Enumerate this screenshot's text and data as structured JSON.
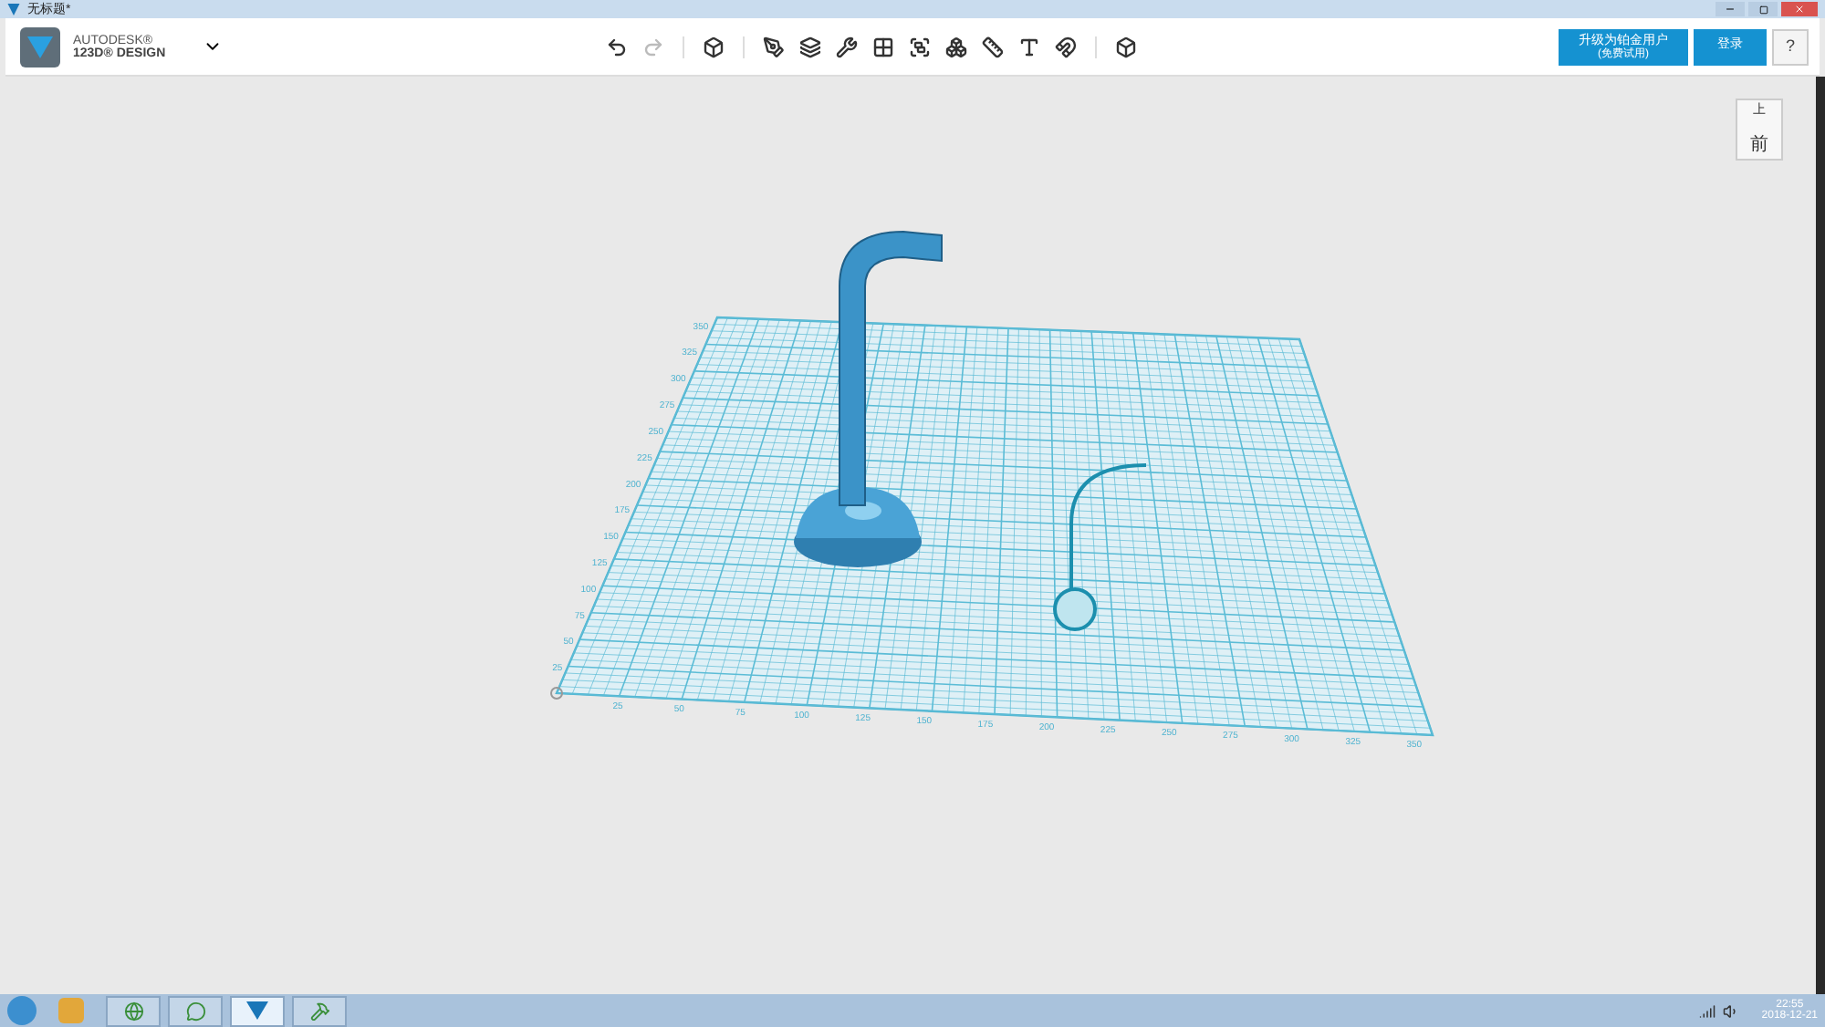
{
  "window": {
    "title": "无标题*"
  },
  "logo": {
    "brand": "AUTODESK®",
    "product": "123D® DESIGN"
  },
  "toolbar": {
    "groups": [
      {
        "tools": [
          {
            "kind": "undo"
          },
          {
            "kind": "redo"
          }
        ]
      },
      {
        "tools": [
          {
            "kind": "primitives"
          }
        ]
      },
      {
        "tools": [
          {
            "kind": "sketch"
          },
          {
            "kind": "construct"
          },
          {
            "kind": "modify"
          },
          {
            "kind": "pattern"
          },
          {
            "kind": "group"
          },
          {
            "kind": "combine"
          },
          {
            "kind": "measure"
          },
          {
            "kind": "text"
          },
          {
            "kind": "snap"
          }
        ]
      },
      {
        "tools": [
          {
            "kind": "material"
          }
        ]
      }
    ]
  },
  "account": {
    "upgrade": "升级为铂金用户",
    "upgrade_note": "(免费试用)",
    "login": "登录",
    "help": "?"
  },
  "view_cube": {
    "top": "上",
    "front": "前"
  },
  "grid": {
    "x_labels": [
      "25",
      "50",
      "75",
      "100",
      "125",
      "150",
      "175",
      "200",
      "225",
      "250",
      "275",
      "300",
      "325",
      "350"
    ],
    "y_labels": [
      "25",
      "50",
      "75",
      "100",
      "125",
      "150",
      "175",
      "200",
      "225",
      "250",
      "275",
      "300",
      "325",
      "350"
    ]
  },
  "taskbar": {
    "apps": [
      {
        "kind": "browser",
        "active": false
      },
      {
        "kind": "chat",
        "active": false
      },
      {
        "kind": "design",
        "active": true
      },
      {
        "kind": "tool",
        "active": false
      }
    ],
    "time": "22:55",
    "date": "2018-12-21"
  }
}
